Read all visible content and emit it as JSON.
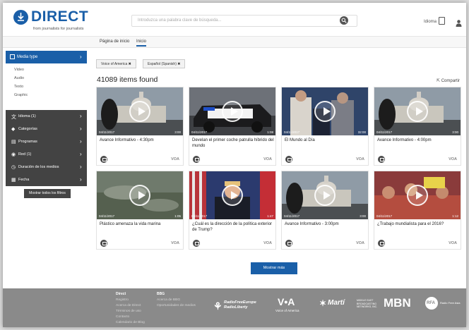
{
  "header": {
    "logo_text": "DIRECT",
    "logo_tagline": "from journalists for journalists",
    "search_placeholder": "Introduzca una palabra clave de búsqueda...",
    "language": "Idioma"
  },
  "tabs": [
    {
      "label": "Página de inicio",
      "active": false
    },
    {
      "label": "Inicio",
      "active": true
    }
  ],
  "sidebar": {
    "media_type": "Media type",
    "media_types": [
      "Video",
      "Audio",
      "Texto",
      "Graphic"
    ],
    "filters": [
      {
        "label": "Idioma (1)",
        "icon": "language-icon"
      },
      {
        "label": "Categorías",
        "icon": "tag-icon"
      },
      {
        "label": "Programas",
        "icon": "program-icon"
      },
      {
        "label": "Red (1)",
        "icon": "network-icon"
      },
      {
        "label": "Duración de los medios",
        "icon": "clock-icon"
      },
      {
        "label": "Fecha",
        "icon": "calendar-icon"
      }
    ],
    "show_filters_label": "Mostrar todos los filtros"
  },
  "active_filters": [
    "Voice of America",
    "Español (Spanish)"
  ],
  "results": {
    "count_text": "41089 items found",
    "share_label": "Compartir",
    "more_label": "Mostrar más"
  },
  "cards": [
    {
      "date": "04/11/2017",
      "duration": "3:00",
      "title": "Avance Informativo - 4:30pm",
      "thumb": "capitol",
      "source": "VOA"
    },
    {
      "date": "04/11/2017",
      "duration": "1:08",
      "title": "Develan el primer coche patrulla híbrido del mundo",
      "thumb": "police",
      "source": "VOA"
    },
    {
      "date": "04/11/2017",
      "duration": "32:00",
      "title": "El Mundo al Día",
      "thumb": "people",
      "source": "VOA"
    },
    {
      "date": "04/11/2017",
      "duration": "3:00",
      "title": "Avance Informativo - 4:00pm",
      "thumb": "capitol",
      "source": "VOA"
    },
    {
      "date": "04/11/2017",
      "duration": "1:05",
      "title": "Plástico amenaza la vida marina",
      "thumb": "water",
      "source": "VOA"
    },
    {
      "date": "04/11/2017",
      "duration": "1:47",
      "title": "¿Cuál es la dirección de la política exterior de Trump?",
      "thumb": "trump",
      "source": "VOA"
    },
    {
      "date": "04/11/2017",
      "duration": "3:00",
      "title": "Avance Informativo - 3:00pm",
      "thumb": "capitol",
      "source": "VOA"
    },
    {
      "date": "04/11/2017",
      "duration": "1:12",
      "title": "¿Trabajo mundialista para el 2016?",
      "thumb": "crowd",
      "source": "VOA"
    }
  ],
  "footer": {
    "col1_heading": "Direct",
    "col1_links": [
      "Registro",
      "Acerca de Direct",
      "Términos de uso",
      "Contacto",
      "Calendario de Blog"
    ],
    "col2_heading": "BBG",
    "col2_links": [
      "Acerca de BBG",
      "Oportunidades de medios"
    ],
    "brands": {
      "rferl": "RadioFreeEurope RadioLiberty",
      "voa_mark": "V•A",
      "voa_sub": "Voice of America",
      "marti": "Martí",
      "mbn_small": "MIDDLE EAST BROADCASTING NETWORKS, INC.",
      "mbn": "MBN",
      "rfa": "RFA",
      "rfa_sub": "Radio Free Asia"
    }
  }
}
